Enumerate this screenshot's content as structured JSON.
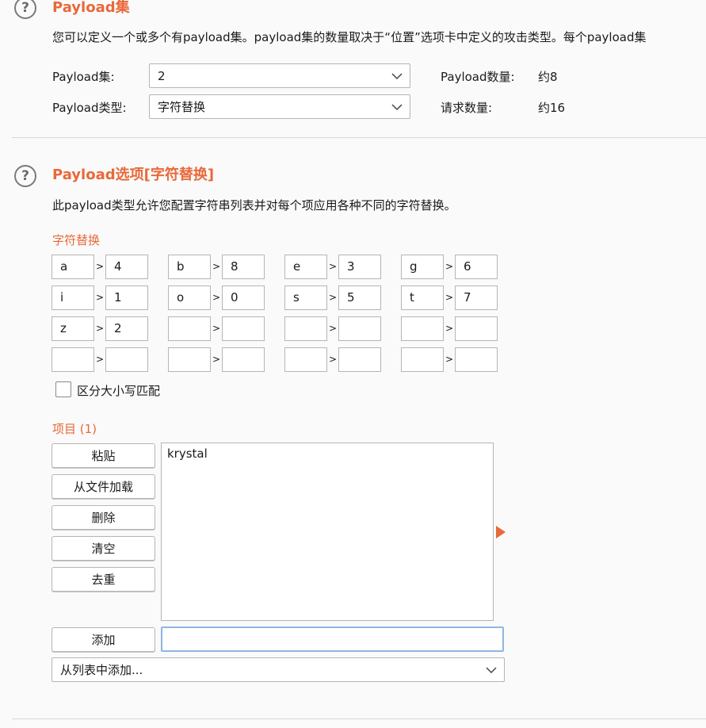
{
  "payload_sets": {
    "title": "Payload集",
    "description": "您可以定义一个或多个有payload集。payload集的数量取决于“位置”选项卡中定义的攻击类型。每个payload集",
    "set_label": "Payload集:",
    "set_value": "2",
    "type_label": "Payload类型:",
    "type_value": "字符替换",
    "count_label": "Payload数量:",
    "count_value": "约8",
    "request_label": "请求数量:",
    "request_value": "约16"
  },
  "payload_options": {
    "title": "Payload选项[字符替换]",
    "description": "此payload类型允许您配置字符串列表并对每个项应用各种不同的字符替换。",
    "substitution_label": "字符替换",
    "gt_symbol": ">",
    "rows": [
      [
        [
          "a",
          "4"
        ],
        [
          "b",
          "8"
        ],
        [
          "e",
          "3"
        ],
        [
          "g",
          "6"
        ]
      ],
      [
        [
          "i",
          "1"
        ],
        [
          "o",
          "0"
        ],
        [
          "s",
          "5"
        ],
        [
          "t",
          "7"
        ]
      ],
      [
        [
          "z",
          "2"
        ],
        [
          "",
          ""
        ],
        [
          "",
          ""
        ],
        [
          "",
          ""
        ]
      ],
      [
        [
          "",
          ""
        ],
        [
          "",
          ""
        ],
        [
          "",
          ""
        ],
        [
          "",
          ""
        ]
      ]
    ],
    "case_sensitive_label": "区分大小写匹配",
    "case_sensitive_checked": false,
    "items_label": "项目 (1)",
    "buttons": {
      "paste": "粘贴",
      "load": "从文件加载",
      "remove": "删除",
      "clear": "清空",
      "dedupe": "去重",
      "add": "添加"
    },
    "items": [
      "krystal"
    ],
    "add_input_value": "",
    "add_from_list": "从列表中添加..."
  },
  "colors": {
    "accent": "#e8693a",
    "border": "#b5b5b5",
    "focus": "#8fb5e0"
  }
}
